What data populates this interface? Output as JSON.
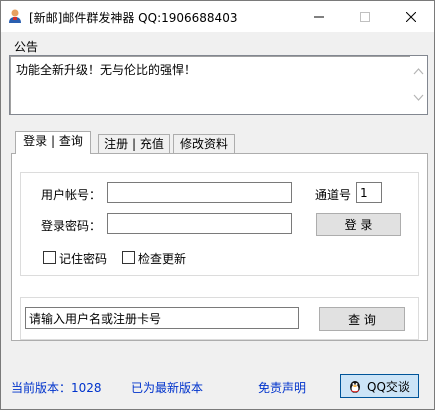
{
  "window": {
    "title": "[新邮]邮件群发神器 QQ:1906688403"
  },
  "notice": {
    "label": "公告",
    "text": "功能全新升级！无与伦比的强悍！"
  },
  "tabs": [
    {
      "label": "登录 | 查询",
      "active": true
    },
    {
      "label": "注册 | 充值",
      "active": false
    },
    {
      "label": "修改资料",
      "active": false
    }
  ],
  "login": {
    "account_label": "用户帐号：",
    "account_value": "",
    "password_label": "登录密码：",
    "password_value": "",
    "channel_label": "通道号",
    "channel_value": "1",
    "login_button": "登 录",
    "remember_label": "记住密码",
    "update_label": "检查更新"
  },
  "search": {
    "input_value": "请输入用户名或注册卡号",
    "button": "查 询"
  },
  "footer": {
    "version_label": "当前版本：1028",
    "status": "已为最新版本",
    "disclaimer": "免责声明",
    "qq_button": "QQ交谈"
  },
  "colors": {
    "accent_blue": "#0033cc",
    "qq_button_bg": "#cce4f7"
  }
}
